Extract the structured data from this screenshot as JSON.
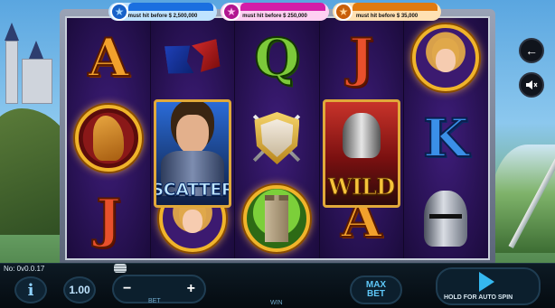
{
  "jackpots": [
    {
      "tier": "blue",
      "icon": "star-icon",
      "text": "must hit before $ 2,500,000"
    },
    {
      "tier": "pink",
      "icon": "star-icon",
      "text": "must hit before $ 250,000"
    },
    {
      "tier": "orange",
      "icon": "star-icon",
      "text": "must hit before $ 35,000"
    }
  ],
  "reels": {
    "reel1": {
      "top": "A",
      "mid": "horse-medallion-icon",
      "bot": "J"
    },
    "reel2": {
      "top": "flags-icon",
      "tall": "SCATTER",
      "bot": "lady-medallion-icon"
    },
    "reel3": {
      "top": "Q",
      "mid": "shield-swords-icon",
      "bot": "tower-medallion-icon"
    },
    "reel4": {
      "top": "J",
      "tall": "WILD",
      "bot": "A"
    },
    "reel5": {
      "top": "lady-medallion-icon",
      "mid": "K",
      "bot": "helmet-icon"
    }
  },
  "side_controls": {
    "back_icon": "arrow-left-icon",
    "sound_icon": "speaker-muted-icon"
  },
  "bottom_bar": {
    "version": "No: 0v0.0.17",
    "info_label": "i",
    "coin_value": "1.00",
    "bet_minus": "−",
    "bet_plus": "+",
    "bet_label": "BET",
    "win_label": "WIN",
    "max_bet_line1": "MAX",
    "max_bet_line2": "BET",
    "spin_hint": "HOLD FOR AUTO SPIN"
  },
  "colors": {
    "accent": "#35b8f0",
    "jackpot_blue": "#1a6fe0",
    "jackpot_pink": "#d21ea8",
    "jackpot_orange": "#e07a10"
  }
}
